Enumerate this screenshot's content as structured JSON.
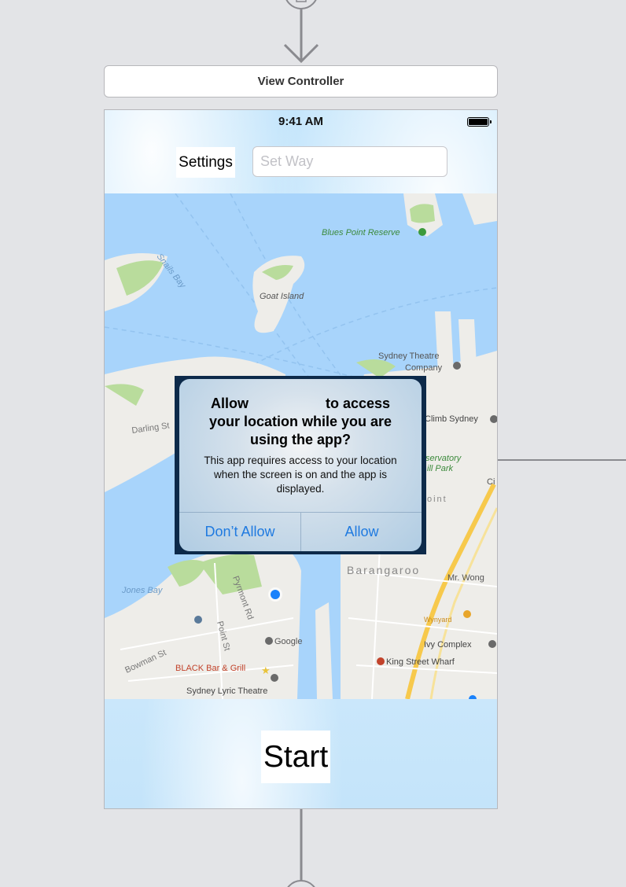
{
  "storyboard": {
    "scene_title": "View Controller"
  },
  "status_bar": {
    "time": "9:41 AM"
  },
  "toolbar": {
    "settings_label": "Settings",
    "way_placeholder": "Set Way"
  },
  "map": {
    "labels": {
      "blues_point": "Blues Point Reserve",
      "snails_bay": "Snails Bay",
      "goat_island": "Goat Island",
      "sydney_theatre": "Sydney Theatre",
      "company": "Company",
      "darling_st": "Darling St",
      "climb_sydney": "Climb Sydney",
      "observatory": "servatory",
      "hill_park": "ill Park",
      "ci": "Ci",
      "barangaroo": "Barangaroo",
      "mr_wong": "Mr. Wong",
      "jones_bay": "Jones Bay",
      "pyrmont_rd": "Pyrmont Rd",
      "point_st": "Point St",
      "google": "Google",
      "wynyard": "Wynyard",
      "ivy_complex": "Ivy Complex",
      "king_street_wharf": "King Street Wharf",
      "bowman_st": "Bowman St",
      "black_bar": "BLACK Bar & Grill",
      "lyric_theatre": "Sydney Lyric Theatre",
      "point_partial": "oint"
    },
    "colors": {
      "water": "#a8d4fb",
      "land": "#eeede9",
      "park": "#b9dc9c",
      "road": "#f7c94c",
      "location": "#1a82fb"
    }
  },
  "alert": {
    "title_line1_left": "Allow",
    "title_line1_right": "to access",
    "title_line2": "your location while you are",
    "title_line3": "using the app?",
    "message": "This app requires access to your location when the screen is on and the app is displayed.",
    "dont_allow_label": "Don’t Allow",
    "allow_label": "Allow",
    "button_color": "#1f7ae0"
  },
  "bottom": {
    "start_label": "Start"
  }
}
